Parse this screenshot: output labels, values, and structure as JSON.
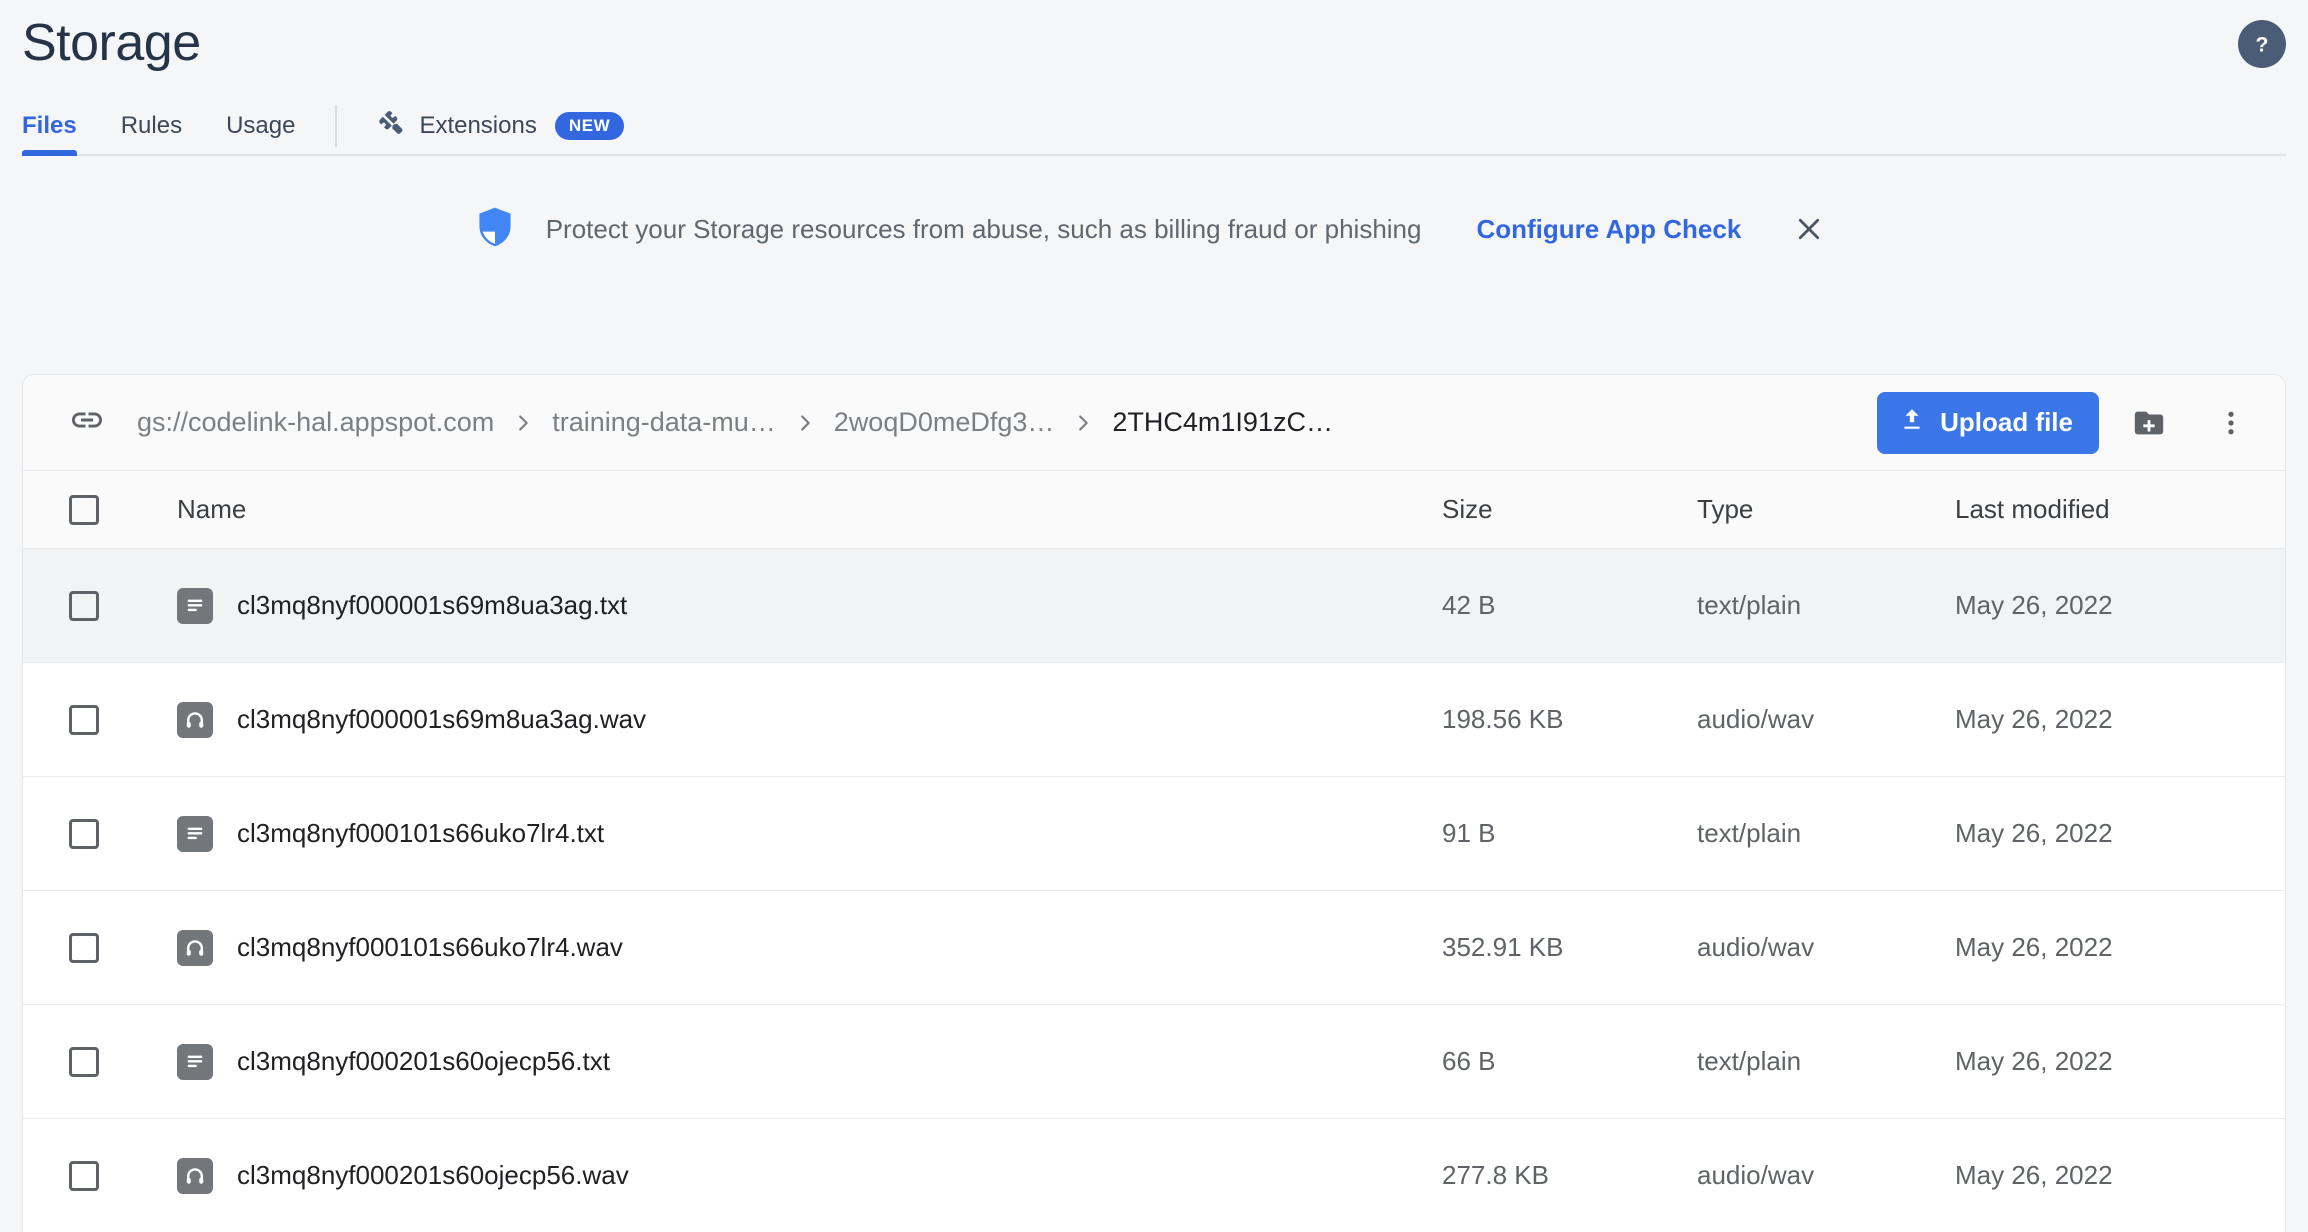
{
  "header": {
    "title": "Storage",
    "help_icon": "help-circle-icon"
  },
  "tabs": [
    {
      "label": "Files",
      "active": true
    },
    {
      "label": "Rules",
      "active": false
    },
    {
      "label": "Usage",
      "active": false
    },
    {
      "label": "Extensions",
      "active": false,
      "icon": "puzzle-icon",
      "badge": "NEW"
    }
  ],
  "banner": {
    "icon": "shield-icon",
    "message": "Protect your Storage resources from abuse, such as billing fraud or phishing",
    "link_label": "Configure App Check",
    "close_icon": "close-icon"
  },
  "breadcrumb": {
    "link_icon": "link-icon",
    "separator": "chevron-right-icon",
    "items": [
      {
        "label": "gs://codelink-hal.appspot.com",
        "current": false
      },
      {
        "label": "training-data-mu…",
        "current": false
      },
      {
        "label": "2woqD0meDfg3…",
        "current": false
      },
      {
        "label": "2THC4m1I91zC…",
        "current": true
      }
    ]
  },
  "toolbar": {
    "upload_label": "Upload file",
    "upload_icon": "upload-icon",
    "create_folder_icon": "folder-add-icon",
    "overflow_icon": "more-vert-icon"
  },
  "table": {
    "columns": [
      "Name",
      "Size",
      "Type",
      "Last modified"
    ],
    "rows": [
      {
        "icon": "text-file-icon",
        "name": "cl3mq8nyf000001s69m8ua3ag.txt",
        "size": "42 B",
        "type": "text/plain",
        "modified": "May 26, 2022",
        "hovered": true
      },
      {
        "icon": "audio-file-icon",
        "name": "cl3mq8nyf000001s69m8ua3ag.wav",
        "size": "198.56 KB",
        "type": "audio/wav",
        "modified": "May 26, 2022",
        "hovered": false
      },
      {
        "icon": "text-file-icon",
        "name": "cl3mq8nyf000101s66uko7lr4.txt",
        "size": "91 B",
        "type": "text/plain",
        "modified": "May 26, 2022",
        "hovered": false
      },
      {
        "icon": "audio-file-icon",
        "name": "cl3mq8nyf000101s66uko7lr4.wav",
        "size": "352.91 KB",
        "type": "audio/wav",
        "modified": "May 26, 2022",
        "hovered": false
      },
      {
        "icon": "text-file-icon",
        "name": "cl3mq8nyf000201s60ojecp56.txt",
        "size": "66 B",
        "type": "text/plain",
        "modified": "May 26, 2022",
        "hovered": false
      },
      {
        "icon": "audio-file-icon",
        "name": "cl3mq8nyf000201s60ojecp56.wav",
        "size": "277.8 KB",
        "type": "audio/wav",
        "modified": "May 26, 2022",
        "hovered": false
      }
    ]
  },
  "colors": {
    "accent": "#3367e0",
    "upload_button": "#3b76e8",
    "title_text": "#263449",
    "muted_text": "#5f6368",
    "page_bg": "#f5f6f7",
    "row_hover": "#f1f3f4"
  }
}
